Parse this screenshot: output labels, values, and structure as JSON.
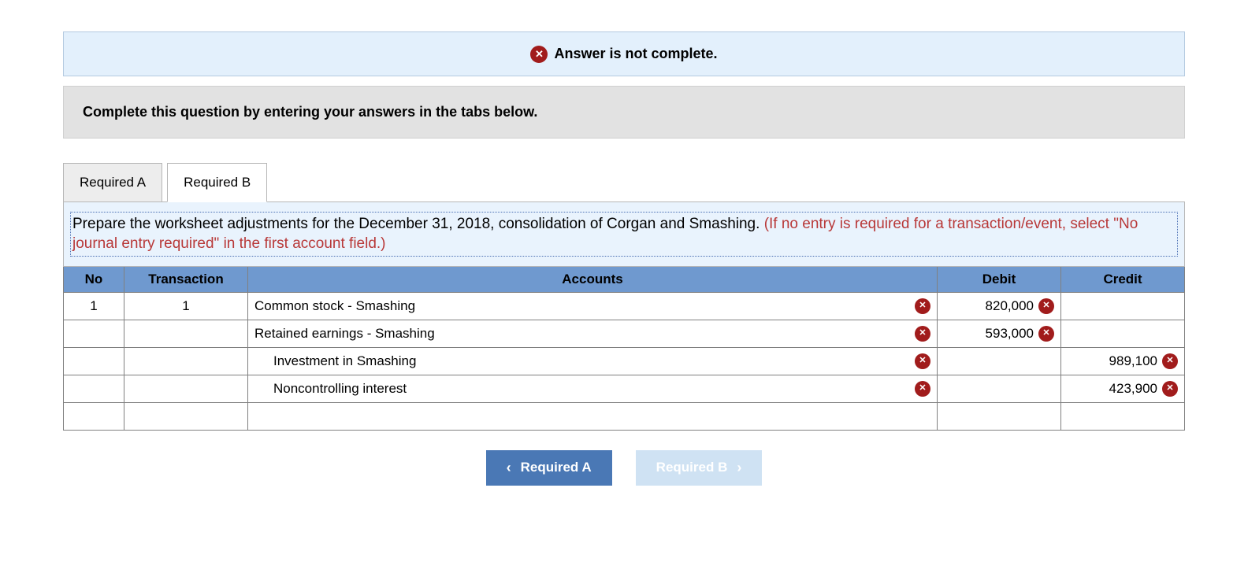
{
  "status": {
    "text": "Answer is not complete."
  },
  "instruction": "Complete this question by entering your answers in the tabs below.",
  "tabs": [
    {
      "label": "Required A",
      "active": false
    },
    {
      "label": "Required B",
      "active": true
    }
  ],
  "prompt": {
    "text": "Prepare the worksheet adjustments for the December 31, 2018, consolidation of Corgan and Smashing. ",
    "hint": "(If no entry is required for a transaction/event, select \"No journal entry required\" in the first account field.)"
  },
  "table": {
    "headers": {
      "no": "No",
      "transaction": "Transaction",
      "accounts": "Accounts",
      "debit": "Debit",
      "credit": "Credit"
    },
    "rows": [
      {
        "no": "1",
        "txn": "1",
        "account": "Common stock - Smashing",
        "indent": false,
        "acct_err": true,
        "debit": "820,000",
        "debit_err": true,
        "credit": "",
        "credit_err": false
      },
      {
        "no": "",
        "txn": "",
        "account": "Retained earnings - Smashing",
        "indent": false,
        "acct_err": true,
        "debit": "593,000",
        "debit_err": true,
        "credit": "",
        "credit_err": false
      },
      {
        "no": "",
        "txn": "",
        "account": "Investment in Smashing",
        "indent": true,
        "acct_err": true,
        "debit": "",
        "debit_err": false,
        "credit": "989,100",
        "credit_err": true
      },
      {
        "no": "",
        "txn": "",
        "account": "Noncontrolling interest",
        "indent": true,
        "acct_err": true,
        "debit": "",
        "debit_err": false,
        "credit": "423,900",
        "credit_err": true
      },
      {
        "no": "",
        "txn": "",
        "account": "",
        "indent": false,
        "acct_err": false,
        "debit": "",
        "debit_err": false,
        "credit": "",
        "credit_err": false
      }
    ]
  },
  "nav": {
    "prev": "Required A",
    "next": "Required B"
  }
}
